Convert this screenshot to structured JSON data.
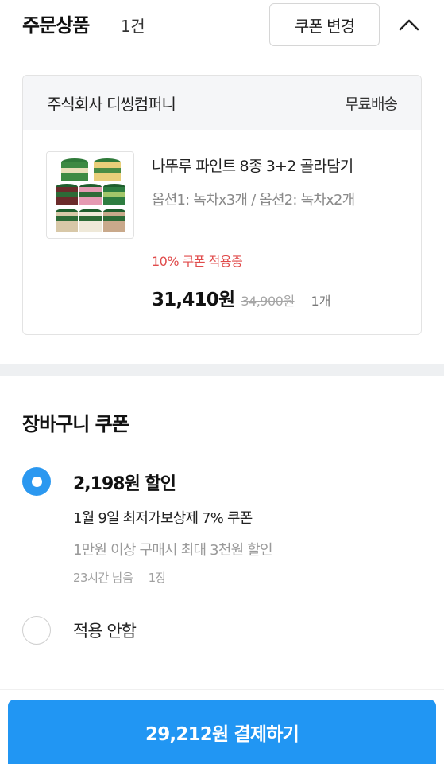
{
  "order_section": {
    "title": "주문상품",
    "count": "1건",
    "coupon_change_button": "쿠폰 변경",
    "collapse_icon": "chevron-up-icon"
  },
  "seller": {
    "name": "주식회사 디씽컴퍼니",
    "shipping": "무료배송"
  },
  "product": {
    "name": "나뚜루 파인트 8종 3+2 골라담기",
    "option": "옵션1: 녹차x3개 / 옵션2: 녹차x2개",
    "coupon_status": "10% 쿠폰 적용중",
    "sale_price": "31,410원",
    "original_price": "34,900원",
    "quantity": "1개",
    "thumbnail_icon": "ice-cream-pints-thumbnail"
  },
  "cart_coupon": {
    "title": "장바구니 쿠폰",
    "options": [
      {
        "selected": true,
        "discount": "2,198원 할인",
        "name": "1월 9일 최저가보상제 7% 쿠폰",
        "condition": "1만원 이상 구매시 최대 3천원 할인",
        "time_left": "23시간 남음",
        "count": "1장"
      },
      {
        "selected": false,
        "label": "적용 안함"
      }
    ]
  },
  "payment": {
    "button_label": "29,212원 결제하기"
  },
  "colors": {
    "accent": "#2196f3",
    "radio": "#2b98f0",
    "coupon_red": "#e04b4b",
    "section_gray": "#eef0f2"
  }
}
